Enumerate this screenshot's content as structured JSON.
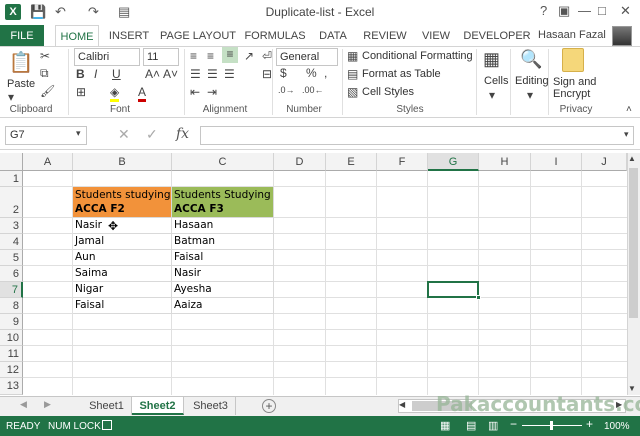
{
  "window": {
    "title": "Duplicate-list - Excel",
    "controls": {
      "help": "?",
      "restore": "▣",
      "minimize": "—",
      "maximize": "□",
      "close": "✕"
    }
  },
  "qat": {
    "save": "💾",
    "undo": "↶",
    "redo": "↷"
  },
  "tabs": {
    "file": "FILE",
    "items": [
      "HOME",
      "INSERT",
      "PAGE LAYOUT",
      "FORMULAS",
      "DATA",
      "REVIEW",
      "VIEW",
      "DEVELOPER"
    ]
  },
  "user": {
    "name": "Hasaan Fazal"
  },
  "ribbon": {
    "clipboard": {
      "paste": "Paste",
      "label": "Clipboard"
    },
    "font": {
      "name": "Calibri",
      "size": "11",
      "bold": "B",
      "italic": "I",
      "underline": "U",
      "label": "Font"
    },
    "alignment": {
      "label": "Alignment"
    },
    "number": {
      "format": "General",
      "currency": "$",
      "percent": "%",
      "comma": ",",
      "label": "Number"
    },
    "styles": {
      "conditional": "Conditional Formatting",
      "table": "Format as Table",
      "cell_styles": "Cell Styles",
      "label": "Styles"
    },
    "cells": {
      "label": "Cells"
    },
    "editing": {
      "label": "Editing"
    },
    "privacy": {
      "sign1": "Sign and",
      "sign2": "Encrypt",
      "label": "Privacy"
    }
  },
  "formula_bar": {
    "name_box": "G7",
    "fx": "fx",
    "value": ""
  },
  "columns": [
    "A",
    "B",
    "C",
    "D",
    "E",
    "F",
    "G",
    "H",
    "I",
    "J"
  ],
  "rows": [
    "1",
    "2",
    "3",
    "4",
    "5",
    "6",
    "7",
    "8",
    "9",
    "10",
    "11",
    "12",
    "13"
  ],
  "table": {
    "header_b": {
      "line1": "Students studying",
      "line2": "ACCA F2"
    },
    "header_c": {
      "line1": "Students Studying",
      "line2": "ACCA F3"
    },
    "col_b": [
      "Nasir",
      "Jamal",
      "Aun",
      "Saima",
      "Nigar",
      "Faisal"
    ],
    "col_c": [
      "Hasaan",
      "Batman",
      "Faisal",
      "Nasir",
      "Ayesha",
      "Aaiza"
    ]
  },
  "colors": {
    "header_b_fill": "#F2923A",
    "header_c_fill": "#9BBB59",
    "excel_green": "#217346"
  },
  "sheets": [
    "Sheet1",
    "Sheet2",
    "Sheet3"
  ],
  "active_sheet": "Sheet2",
  "status": {
    "ready": "READY",
    "num_lock": "NUM LOCK",
    "zoom": "100%"
  },
  "watermark": "Pakaccountants.com"
}
